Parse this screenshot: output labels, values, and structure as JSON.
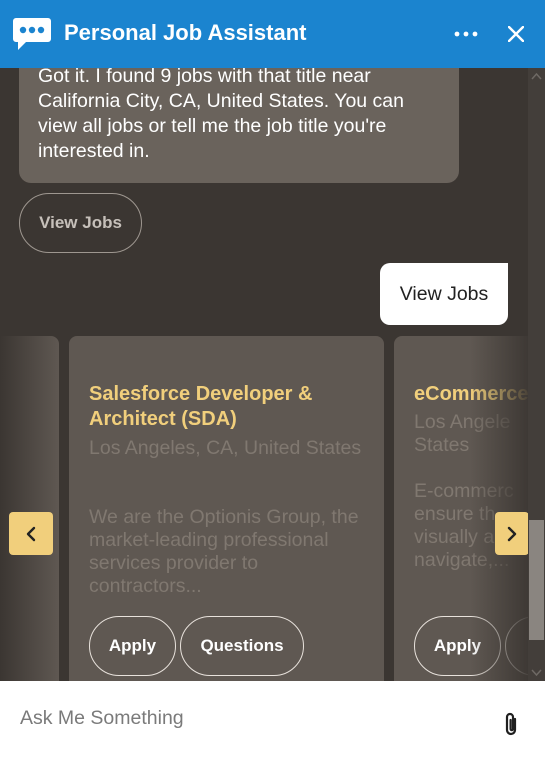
{
  "header": {
    "title": "Personal Job Assistant",
    "logo_icon": "chat-bubble-icon",
    "more_icon": "more-horizontal-icon",
    "close_icon": "close-icon",
    "color": "#1b84cf"
  },
  "chat": {
    "bot_message_lines": [
      "Got it. I found 9 jobs with that title near",
      "California City, CA, United States. You can",
      "view all jobs or tell me the job title you're",
      "interested in."
    ],
    "quick_reply": "View Jobs",
    "user_message": "View Jobs"
  },
  "carousel": {
    "cards": [
      {
        "title": "Salesforce Developer & Architect (SDA)",
        "location": "Los Angeles, CA, United States",
        "description": "We are the Optionis Group, the market-leading professional services provider to contractors...",
        "apply_label": "Apply",
        "questions_label": "Questions"
      },
      {
        "title": "eCommerce",
        "location": "Los Angele States",
        "description": "E-commerc ensure th visually a navigate,...",
        "apply_label": "Apply"
      }
    ],
    "prev_icon": "chevron-left-icon",
    "next_icon": "chevron-right-icon",
    "accent": "#f1cf7c"
  },
  "input": {
    "placeholder": "Ask Me Something",
    "attach_icon": "paperclip-icon"
  }
}
